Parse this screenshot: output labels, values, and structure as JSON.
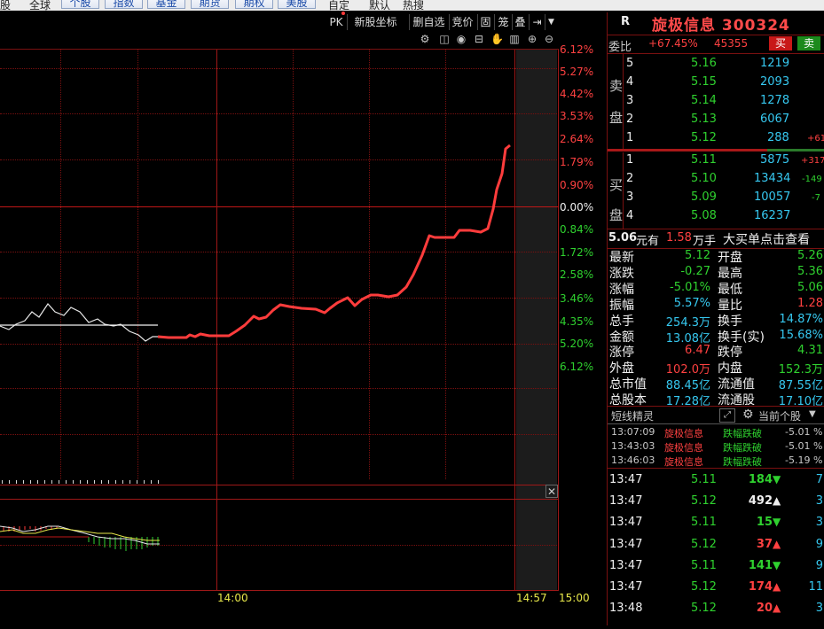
{
  "topnav": {
    "items": [
      "股",
      "全球",
      "个股",
      "指数",
      "基金",
      "期货",
      "期权",
      "美股",
      "自定",
      "默认",
      "热搜"
    ]
  },
  "toolbar": {
    "pk": "PK",
    "new_coord": "新股坐标",
    "del_fav": "删自选",
    "auction": "竞价",
    "gu": "固",
    "long": "笼",
    "overlay": "叠"
  },
  "chart": {
    "percent_labels": [
      "6.12%",
      "5.27%",
      "4.42%",
      "3.53%",
      "2.64%",
      "1.79%",
      "0.90%",
      "0.00%",
      "0.84%",
      "1.72%",
      "2.58%",
      "3.46%",
      "4.35%",
      "5.20%",
      "6.12%"
    ],
    "time_labels": {
      "t1400": "14:00",
      "t1457": "14:57",
      "t1500": "15:00"
    },
    "series_color": "#ff3c3c"
  },
  "stock": {
    "r_badge": "R",
    "name_code": "旋极信息 300324"
  },
  "orderbook": {
    "wb_label": "委比",
    "wb_pct": "+67.45%",
    "wb_diff": "45355",
    "buy_btn": "买",
    "sell_btn": "卖",
    "sell_side_label": [
      "卖",
      "盘"
    ],
    "buy_side_label": [
      "买",
      "盘"
    ],
    "sell": [
      {
        "lvl": "5",
        "price": "5.16",
        "vol": "1219",
        "chg": ""
      },
      {
        "lvl": "4",
        "price": "5.15",
        "vol": "2093",
        "chg": ""
      },
      {
        "lvl": "3",
        "price": "5.14",
        "vol": "1278",
        "chg": ""
      },
      {
        "lvl": "2",
        "price": "5.13",
        "vol": "6067",
        "chg": ""
      },
      {
        "lvl": "1",
        "price": "5.12",
        "vol": "288",
        "chg": "+61"
      }
    ],
    "buy": [
      {
        "lvl": "1",
        "price": "5.11",
        "vol": "5875",
        "chg": "+317"
      },
      {
        "lvl": "2",
        "price": "5.10",
        "vol": "13434",
        "chg": "-149"
      },
      {
        "lvl": "3",
        "price": "5.09",
        "vol": "10057",
        "chg": "-7"
      },
      {
        "lvl": "4",
        "price": "5.08",
        "vol": "16237",
        "chg": ""
      }
    ]
  },
  "bigorder": {
    "price": "5.06",
    "unit1": "元有",
    "vol": "1.58",
    "unit2": "万手",
    "text": "大买单点击查看"
  },
  "stats": [
    {
      "l1": "最新",
      "v1": "5.12",
      "c1": "green",
      "l2": "开盘",
      "v2": "5.26",
      "c2": "green"
    },
    {
      "l1": "涨跌",
      "v1": "-0.27",
      "c1": "green",
      "l2": "最高",
      "v2": "5.36",
      "c2": "green"
    },
    {
      "l1": "涨幅",
      "v1": "-5.01%",
      "c1": "green",
      "l2": "最低",
      "v2": "5.06",
      "c2": "green"
    },
    {
      "l1": "振幅",
      "v1": "5.57%",
      "c1": "cyan",
      "l2": "量比",
      "v2": "1.28",
      "c2": "red"
    },
    {
      "l1": "总手",
      "v1": "254.3万",
      "c1": "cyan",
      "l2": "换手",
      "v2": "14.87%",
      "c2": "cyan"
    },
    {
      "l1": "金额",
      "v1": "13.08亿",
      "c1": "cyan",
      "l2": "换手(实)",
      "v2": "15.68%",
      "c2": "cyan"
    },
    {
      "l1": "涨停",
      "v1": "6.47",
      "c1": "red",
      "l2": "跌停",
      "v2": "4.31",
      "c2": "green"
    },
    {
      "l1": "外盘",
      "v1": "102.0万",
      "c1": "red",
      "l2": "内盘",
      "v2": "152.3万",
      "c2": "green"
    },
    {
      "l1": "总市值",
      "v1": "88.45亿",
      "c1": "cyan",
      "l2": "流通值",
      "v2": "87.55亿",
      "c2": "cyan"
    },
    {
      "l1": "总股本",
      "v1": "17.28亿",
      "c1": "cyan",
      "l2": "流通股",
      "v2": "17.10亿",
      "c2": "cyan"
    }
  ],
  "news": {
    "tab": "短线精灵",
    "filter": "当前个股",
    "rows": [
      {
        "time": "13:07:09",
        "name": "旋极信息",
        "event": "跌幅跌破",
        "val": "-5.01 %"
      },
      {
        "time": "13:43:03",
        "name": "旋极信息",
        "event": "跌幅跌破",
        "val": "-5.01 %"
      },
      {
        "time": "13:46:03",
        "name": "旋极信息",
        "event": "跌幅跌破",
        "val": "-5.19 %"
      }
    ]
  },
  "ticks": [
    {
      "time": "13:47",
      "price": "5.11",
      "pc": "green",
      "vol": "184",
      "dir": "down",
      "extra": "7"
    },
    {
      "time": "13:47",
      "price": "5.12",
      "pc": "green",
      "vol": "492",
      "dir": "up-white",
      "extra": "3"
    },
    {
      "time": "13:47",
      "price": "5.11",
      "pc": "green",
      "vol": "15",
      "dir": "down",
      "extra": "3"
    },
    {
      "time": "13:47",
      "price": "5.12",
      "pc": "green",
      "vol": "37",
      "dir": "up",
      "extra": "9"
    },
    {
      "time": "13:47",
      "price": "5.11",
      "pc": "green",
      "vol": "141",
      "dir": "down",
      "extra": "9"
    },
    {
      "time": "13:47",
      "price": "5.12",
      "pc": "green",
      "vol": "174",
      "dir": "up",
      "extra": "11"
    },
    {
      "time": "13:48",
      "price": "5.12",
      "pc": "green",
      "vol": "20",
      "dir": "up",
      "extra": "3"
    }
  ]
}
